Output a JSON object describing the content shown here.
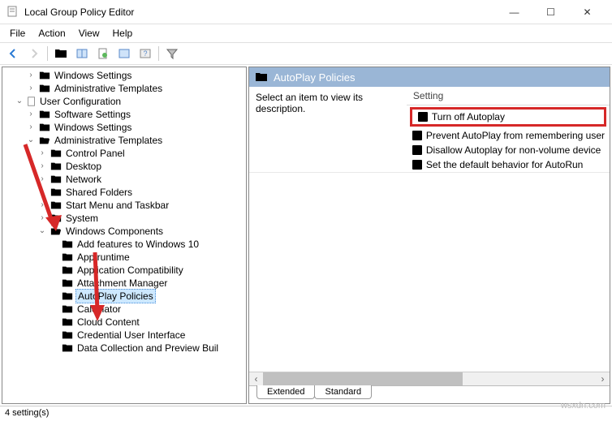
{
  "window": {
    "title": "Local Group Policy Editor",
    "minimize": "—",
    "maximize": "☐",
    "close": "✕"
  },
  "menubar": {
    "file": "File",
    "action": "Action",
    "view": "View",
    "help": "Help"
  },
  "toolbar": {
    "back": "back",
    "forward": "forward",
    "up": "up",
    "props": "properties",
    "refresh": "refresh",
    "export": "export",
    "help": "help",
    "filter": "filter"
  },
  "tree": {
    "n0": "Windows Settings",
    "n1": "Administrative Templates",
    "n2": "User Configuration",
    "n3": "Software Settings",
    "n4": "Windows Settings",
    "n5": "Administrative Templates",
    "n6": "Control Panel",
    "n7": "Desktop",
    "n8": "Network",
    "n9": "Shared Folders",
    "n10": "Start Menu and Taskbar",
    "n11": "System",
    "n12": "Windows Components",
    "n13": "Add features to Windows 10",
    "n14": "App runtime",
    "n15": "Application Compatibility",
    "n16": "Attachment Manager",
    "n17": "AutoPlay Policies",
    "n18": "Calculator",
    "n19": "Cloud Content",
    "n20": "Credential User Interface",
    "n21": "Data Collection and Preview Buil"
  },
  "rightPane": {
    "headerTitle": "AutoPlay Policies",
    "descPrompt": "Select an item to view its description.",
    "settingHeader": "Setting",
    "items": {
      "i0": "Turn off Autoplay",
      "i1": "Prevent AutoPlay from remembering user",
      "i2": "Disallow Autoplay for non-volume device",
      "i3": "Set the default behavior for AutoRun"
    },
    "tabs": {
      "extended": "Extended",
      "standard": "Standard"
    }
  },
  "status": {
    "text": "4 setting(s)"
  },
  "watermark": "wsxdn.com"
}
